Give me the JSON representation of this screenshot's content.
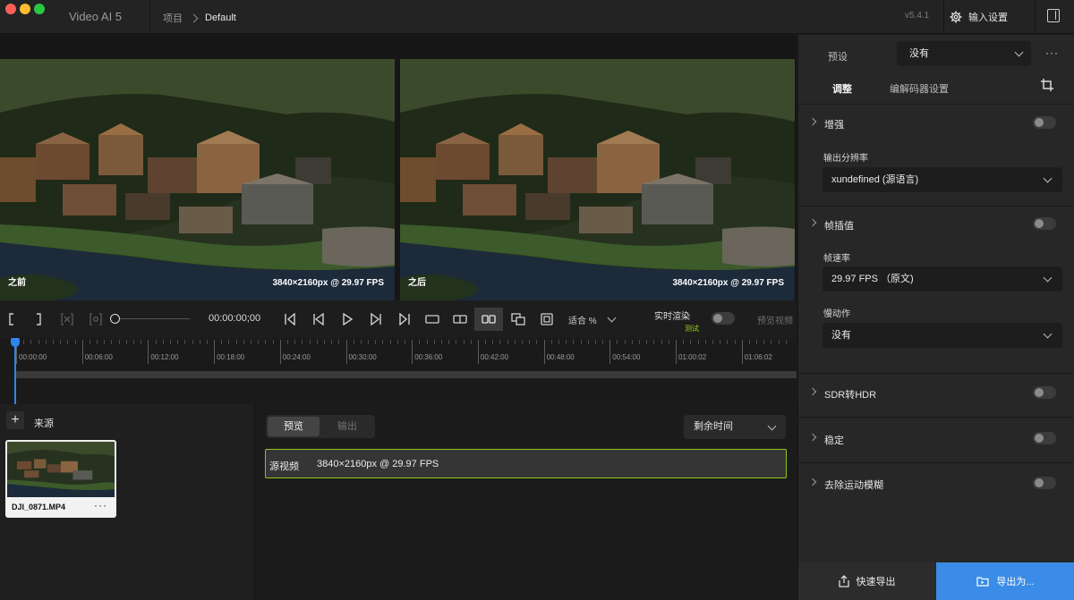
{
  "window": {
    "app_title": "Video AI  5",
    "version": "v5.4.1"
  },
  "breadcrumb": {
    "project": "项目",
    "current": "Default"
  },
  "header": {
    "input_settings_label": "输入设置"
  },
  "preview": {
    "before_label": "之前",
    "after_label": "之后",
    "before_resolution": "3840×2160px @ 29.97 FPS",
    "after_resolution": "3840×2160px @ 29.97 FPS"
  },
  "player": {
    "timecode": "00:00:00;00",
    "fit_label": "适合  %",
    "realtime_label": "实时渲染",
    "beta_label": "测试",
    "preview_video_label": "预览视频"
  },
  "timeline": {
    "ticks": [
      "00:00:00",
      "00:06:00",
      "00:12:00",
      "00:18:00",
      "00:24:00",
      "00:30:00",
      "00:36:00",
      "00:42:00",
      "00:48:00",
      "00:54:00",
      "01:00:02",
      "01:06:02"
    ]
  },
  "sources": {
    "title": "来源",
    "clips": [
      {
        "name": "DJI_0871.MP4"
      }
    ]
  },
  "queue": {
    "tab_preview": "预览",
    "tab_export": "输出",
    "sort_label": "剩余时间",
    "rows": [
      {
        "label": "源视频",
        "value": "3840×2160px @ 29.97 FPS"
      }
    ]
  },
  "settings": {
    "preset_label": "预设",
    "preset_value": "没有",
    "tab_adjust": "调整",
    "tab_codec": "编解码器设置",
    "enhance": "增强",
    "output_resolution_label": "输出分辨率",
    "output_resolution_value": "xundefined (源语言)",
    "frame_interp": "帧插值",
    "frame_rate_label": "帧速率",
    "frame_rate_value": "29.97 FPS （原文)",
    "slowmo_label": "慢动作",
    "slowmo_value": "没有",
    "sdr_hdr": "SDR转HDR",
    "stabilize": "稳定",
    "motion_blur": "去除运动模糊",
    "quick_export": "快速导出",
    "export_as": "导出为..."
  },
  "colors": {
    "accent_blue": "#3a8ce6",
    "accent_green": "#96c21c",
    "playhead": "#2f86ee"
  }
}
